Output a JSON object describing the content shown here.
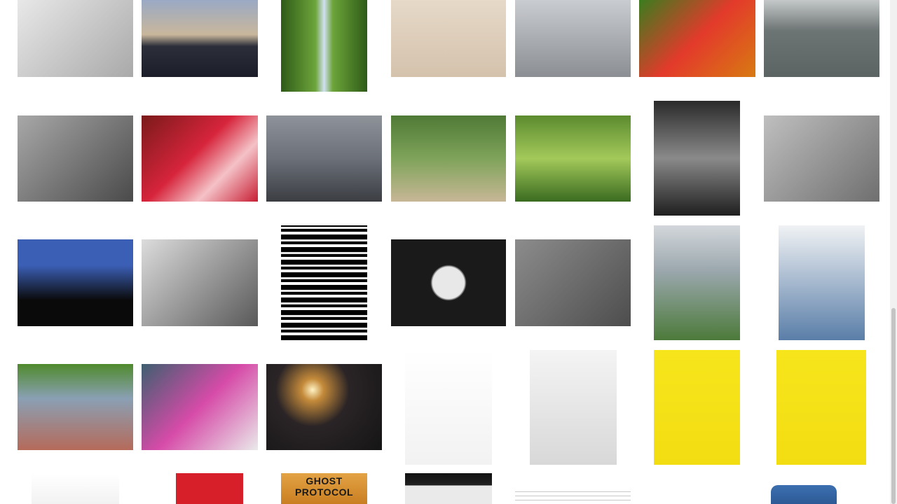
{
  "gallery": {
    "poster_caption": "GHOST PROTOCOL",
    "tiles": [
      {
        "name": "photo-shadow-on-wall",
        "bg": "linear-gradient(135deg,#e8e8e8,#a9a9a9)",
        "icon": "silhouette-icon"
      },
      {
        "name": "photo-city-reflection",
        "bg": "linear-gradient(180deg,#9aa9c4 0%,#c9b79c 45%,#2c2f3a 60%,#1b1e28 100%)",
        "icon": "building-icon"
      },
      {
        "name": "photo-tree-avenue",
        "bg": "linear-gradient(90deg,#2e5b18,#6da43a 40%,#cfe0f0 50%,#6da43a 60%,#2e5b18)",
        "icon": "tree-icon"
      },
      {
        "name": "photo-museum-visitors",
        "bg": "linear-gradient(180deg,#e6d9c8,#d4c2ac)",
        "icon": "people-icon"
      },
      {
        "name": "photo-fountain-kids",
        "bg": "linear-gradient(180deg,#c9ccd0,#8b8e93)",
        "icon": "water-icon"
      },
      {
        "name": "photo-lily-flower",
        "bg": "linear-gradient(135deg,#3a7d1e,#e33a2b 50%,#d87a12)",
        "icon": "flower-icon"
      },
      {
        "name": "photo-grey-bowl",
        "bg": "linear-gradient(180deg,#c4c8c9,#6d7474 40%,#5b6363)",
        "icon": "bowl-icon"
      },
      {
        "name": "photo-blue-window-wall",
        "bg": "linear-gradient(135deg,#a8a8a8,#4a4a4a)",
        "icon": "window-icon"
      },
      {
        "name": "photo-carousel-blur",
        "bg": "linear-gradient(135deg,#7a1a1a,#d6243b 45%,#f4c2c7 70%,#c81e34)",
        "icon": "carousel-icon"
      },
      {
        "name": "photo-man-viewing-city",
        "bg": "linear-gradient(180deg,#8e939a,#6b7079 50%,#3b3d42)",
        "icon": "person-icon"
      },
      {
        "name": "photo-trees-building",
        "bg": "linear-gradient(180deg,#4f7a36,#7fa35a 50%,#c7b796)",
        "icon": "tree-icon"
      },
      {
        "name": "photo-castle-garden",
        "bg": "linear-gradient(180deg,#5c8b2f,#a3c95a 50%,#3a6b20)",
        "icon": "castle-icon"
      },
      {
        "name": "photo-girl-fountain",
        "bg": "linear-gradient(180deg,#2a2a2a,#8a8a8a 50%,#1f1f1f)",
        "icon": "person-icon"
      },
      {
        "name": "photo-drain-grate",
        "bg": "linear-gradient(135deg,#bfbfbf,#6f6f6f)",
        "icon": "grate-icon"
      },
      {
        "name": "photo-blue-alley",
        "bg": "linear-gradient(180deg,#3b5fb5 0%,#3b5fb5 30%,#0a0a0a 70%)",
        "icon": "building-icon"
      },
      {
        "name": "photo-bw-clouds",
        "bg": "linear-gradient(135deg,#dcdcdc,#595959)",
        "icon": "cloud-icon"
      },
      {
        "name": "photo-bw-abstract",
        "bg": "repeating-linear-gradient(0deg,#000 0 7px,#fff 7px 11px,#000 11px 15px,#e6e6e6 15px 18px)",
        "icon": "abstract-icon"
      },
      {
        "name": "photo-bw-tulips",
        "bg": "radial-gradient(circle,#e8e8e8 22%,#1a1a1a 25%)",
        "icon": "flower-icon"
      },
      {
        "name": "photo-concrete-texture",
        "bg": "linear-gradient(135deg,#8c8c8c,#4d4d4d)",
        "icon": "texture-icon"
      },
      {
        "name": "photo-eiffel-tower",
        "bg": "linear-gradient(180deg,#d3d7db,#9aa7ad 40%,#4c7a3a)",
        "icon": "tower-icon"
      },
      {
        "name": "photo-clouds-column",
        "bg": "linear-gradient(180deg,#f0f2f4,#5a7ea8)",
        "icon": "cloud-icon"
      },
      {
        "name": "photo-street-crowd",
        "bg": "linear-gradient(180deg,#4f8a2c,#8aa0b4 40%,#b56a5a)",
        "icon": "people-icon"
      },
      {
        "name": "photo-carousel-girl",
        "bg": "linear-gradient(135deg,#3e5f70,#d64ba8 50%,#eaeaea)",
        "icon": "carousel-icon"
      },
      {
        "name": "photo-man-glowing-ball",
        "bg": "radial-gradient(circle at 40% 30%,#fff3c4 0%,#c48a3a 12%,#2a2426 40%,#151515 100%)",
        "icon": "light-icon"
      },
      {
        "name": "photo-basketball-player",
        "bg": "linear-gradient(180deg,#ffffff,#f2f2f2)",
        "icon": "ball-icon"
      },
      {
        "name": "photo-woman-leather-jacket",
        "bg": "linear-gradient(180deg,#f4f4f4,#d8d8d8)",
        "icon": "person-icon"
      },
      {
        "name": "art-yellow-glasses-1",
        "bg": "linear-gradient(180deg,#f7e51b,#f2dd12)",
        "icon": "glasses-icon"
      },
      {
        "name": "art-yellow-glasses-2",
        "bg": "linear-gradient(180deg,#f7e51b,#f2dd12)",
        "icon": "glasses-icon"
      },
      {
        "name": "logo-laurel-wreath",
        "bg": "linear-gradient(180deg,#ffffff,#f2f2f2)",
        "icon": "laurel-icon"
      },
      {
        "name": "art-red-white-block",
        "bg": "linear-gradient(90deg,#ffffff 0 22%,#d71f2a 22% 100%)",
        "icon": "block-icon"
      },
      {
        "name": "poster-ghost-protocol",
        "bg": "linear-gradient(180deg,#e3a344,#c97e22)",
        "icon": "poster-icon"
      },
      {
        "name": "screenshot-dark-app",
        "bg": "linear-gradient(180deg,#111111,#222222 40%,#eaeaea 40%)",
        "icon": "screen-icon"
      },
      {
        "name": "screenshot-document",
        "bg": "repeating-linear-gradient(180deg,#ffffff 0 5px,#c8c8c8 5px 6px)",
        "icon": "document-icon"
      },
      {
        "name": "app-icon-blue",
        "bg": "linear-gradient(180deg,#3c6fb0,#2d5a96)",
        "icon": "app-icon"
      }
    ]
  }
}
